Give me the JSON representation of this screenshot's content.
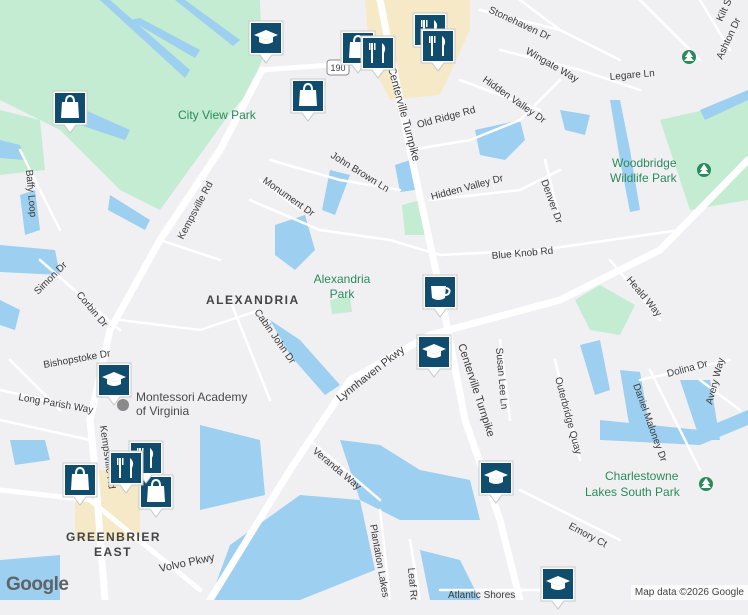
{
  "labels": {
    "city_view_park": "City View Park",
    "alexandria_park": [
      "Alexandria",
      "Park"
    ],
    "alexandria": "ALEXANDRIA",
    "montessori": [
      "Montessori Academy",
      "of Virginia"
    ],
    "woodbridge": [
      "Woodbridge",
      "Wildlife Park"
    ],
    "charlestowne": [
      "Charlestowne",
      "Lakes South Park"
    ],
    "greenbrier": [
      "GREENBRIER",
      "EAST"
    ],
    "route_190": "190"
  },
  "streets": {
    "kempsville_rd": "Kempsville Rd",
    "kempsville_rd_s": "Kempsville Rd",
    "centerville_tpke_n": "Centerville Turnpike",
    "centerville_tpke_s": "Centerville Turnpike",
    "lynnhaven_pkwy": "Lynnhaven Pkwy",
    "volvo_pkwy": "Volvo Pkwy",
    "veranda_way": "Veranda Way",
    "plantation_lakes": "Plantation Lakes",
    "leaf_rd": "Leaf Rd",
    "atlantic_shores": "Atlantic Shores",
    "blue_knob_rd": "Blue Knob Rd",
    "john_brown_ln": "John Brown Ln",
    "monument_dr": "Monument Dr",
    "hidden_valley_dr": "Hidden Valley Dr",
    "hidden_valley_dr2": "Hidden Valley Dr",
    "old_ridge_rd": "Old Ridge Rd",
    "stonehaven_dr": "Stonehaven Dr",
    "wingate_way": "Wingate Way",
    "legare_ln": "Legare Ln",
    "ashton_dr": "Ashton Dr",
    "kilt_st": "Kilt St",
    "denver_dr": "Denver Dr",
    "heald_way": "Heald Way",
    "dolina_dr": "Dolina Dr",
    "avery_way": "Avery Way",
    "daniel_maloney_dr": "Daniel Maloney Dr",
    "outerbridge_quay": "Outerbridge Quay",
    "susan_lee_ln": "Susan Lee Ln",
    "emory_ct": "Emory Ct",
    "cabin_john_dr": "Cabin John Dr",
    "simon_dr": "Simon Dr",
    "corbin_dr": "Corbin Dr",
    "bishopstoke_dr": "Bishopstoke Dr",
    "long_parish_way": "Long Parish Way",
    "baffy_loop": "Baffy Loop"
  },
  "attribution": {
    "logo": "Google",
    "map_data": "Map data ©2026 Google"
  },
  "colors": {
    "background": "#f0f0f3",
    "water": "#9ccff0",
    "park": "#c3ecd2",
    "commercial": "#f5e9c8",
    "road": "#ffffff",
    "marker": "#0f4c6e",
    "park_label": "#2b8a5a"
  },
  "markers": [
    {
      "type": "school",
      "icon": "graduation-cap-icon"
    },
    {
      "type": "shopping",
      "icon": "shopping-bag-icon"
    },
    {
      "type": "shopping",
      "icon": "shopping-bag-icon"
    },
    {
      "type": "shopping",
      "icon": "shopping-bag-icon"
    },
    {
      "type": "restaurant",
      "icon": "fork-knife-icon"
    },
    {
      "type": "restaurant",
      "icon": "fork-knife-icon"
    },
    {
      "type": "restaurant",
      "icon": "fork-knife-icon"
    },
    {
      "type": "cafe",
      "icon": "coffee-cup-icon"
    },
    {
      "type": "school",
      "icon": "graduation-cap-icon"
    },
    {
      "type": "school",
      "icon": "graduation-cap-icon"
    },
    {
      "type": "school",
      "icon": "graduation-cap-icon"
    },
    {
      "type": "school",
      "icon": "graduation-cap-icon"
    },
    {
      "type": "shopping",
      "icon": "shopping-bag-icon"
    },
    {
      "type": "shopping",
      "icon": "shopping-bag-icon"
    },
    {
      "type": "restaurant",
      "icon": "fork-knife-icon"
    },
    {
      "type": "restaurant",
      "icon": "fork-knife-icon"
    }
  ]
}
